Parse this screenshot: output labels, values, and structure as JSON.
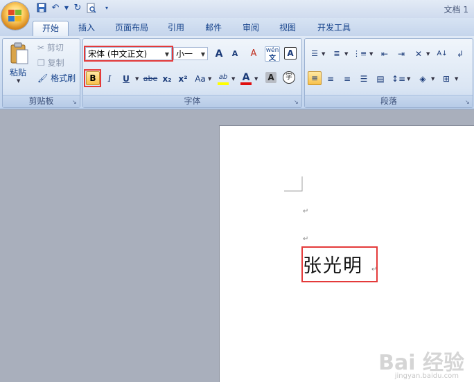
{
  "title_bar": {
    "doc_title": "文档 1"
  },
  "tabs": [
    {
      "label": "开始",
      "active": true
    },
    {
      "label": "插入"
    },
    {
      "label": "页面布局"
    },
    {
      "label": "引用"
    },
    {
      "label": "邮件"
    },
    {
      "label": "审阅"
    },
    {
      "label": "视图"
    },
    {
      "label": "开发工具"
    }
  ],
  "clipboard": {
    "label": "剪贴板",
    "paste": "粘贴",
    "cut": "剪切",
    "copy": "复制",
    "format_painter": "格式刷"
  },
  "font": {
    "label": "字体",
    "font_name": "宋体 (中文正文)",
    "font_size": "小一",
    "bold": "B",
    "italic": "I",
    "underline": "U",
    "strike": "abe",
    "subscript": "x₂",
    "superscript": "x²",
    "change_case": "Aa",
    "grow": "A",
    "shrink": "A",
    "clear": "A",
    "phonetic": "wén",
    "border_char": "A",
    "highlight": "ab",
    "color": "A",
    "shade": "A",
    "enclose": "字"
  },
  "paragraph": {
    "label": "段落"
  },
  "document": {
    "text": "张光明",
    "para_mark": "↵"
  },
  "colors": {
    "highlight_box": "#e43a3a",
    "font_color": "#e01010",
    "highlight_color": "#ffff00"
  },
  "watermark": {
    "brand": "Bai 经验",
    "url": "jingyan.baidu.com"
  }
}
